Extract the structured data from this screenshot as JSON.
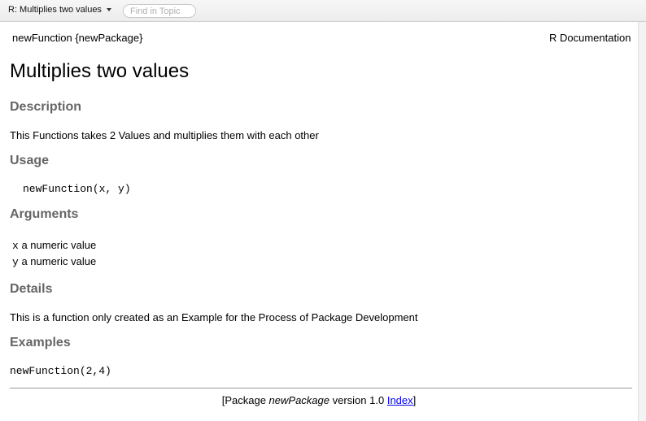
{
  "toolbar": {
    "topic_label": "R: Multiplies two values",
    "find_placeholder": "Find in Topic"
  },
  "doc": {
    "header_left": "newFunction {newPackage}",
    "header_right": "R Documentation",
    "title": "Multiplies two values",
    "description_heading": "Description",
    "description_text": "This Functions takes 2 Values and multiplies them with each other",
    "usage_heading": "Usage",
    "usage_code": "newFunction(x, y)",
    "arguments_heading": "Arguments",
    "arguments": [
      {
        "name": "x",
        "desc": "a numeric value"
      },
      {
        "name": "y",
        "desc": "a numeric value"
      }
    ],
    "details_heading": "Details",
    "details_text": "This is a function only created as an Example for the Process of Package Development",
    "examples_heading": "Examples",
    "examples_code": "newFunction(2,4)"
  },
  "footer": {
    "prefix": "[Package ",
    "package_name": "newPackage",
    "version_text": " version 1.0 ",
    "index_link": "Index",
    "suffix": "]"
  }
}
